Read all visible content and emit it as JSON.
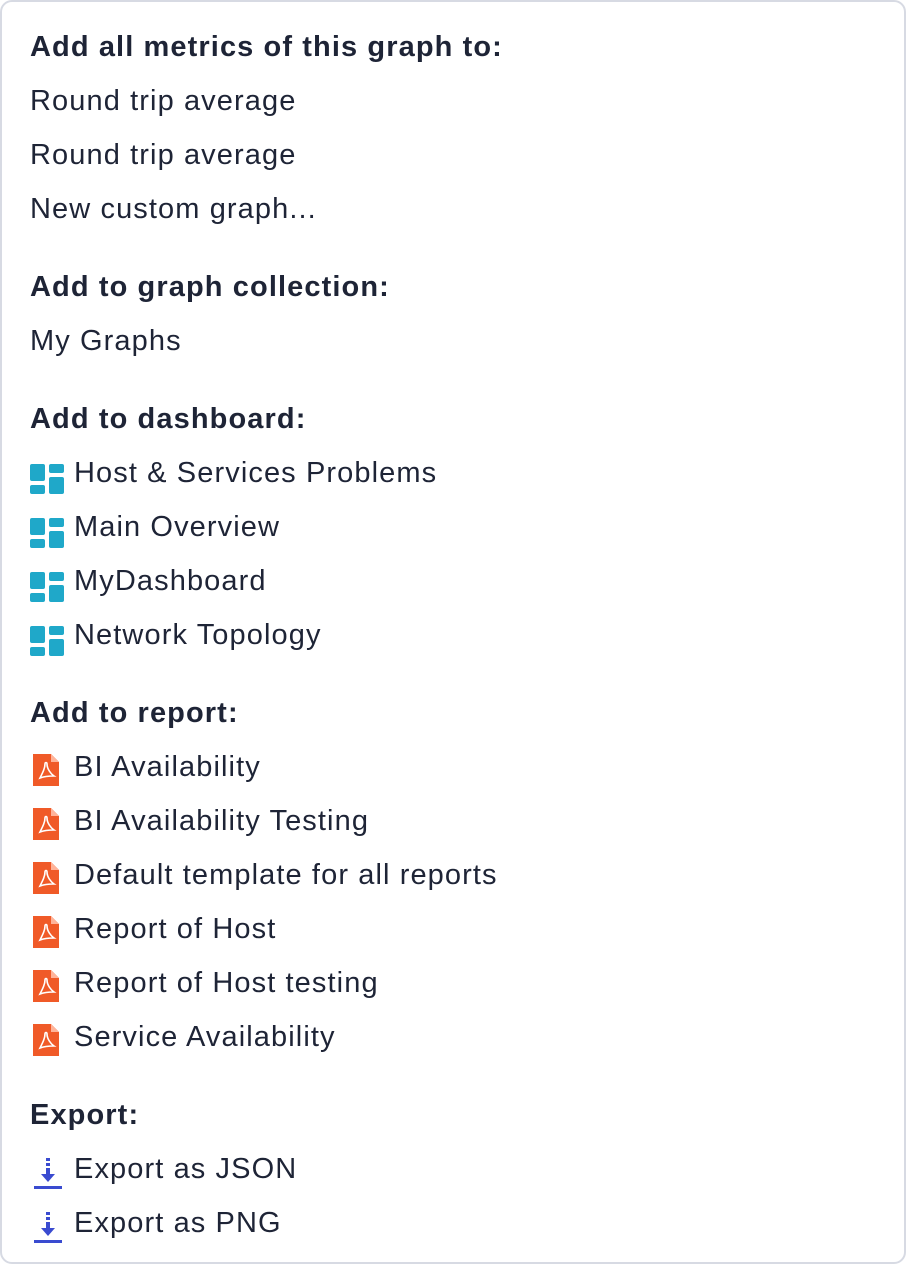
{
  "sections": {
    "metrics": {
      "heading": "Add all metrics of this graph to:",
      "items": [
        "Round trip average",
        "Round trip average",
        "New custom graph..."
      ]
    },
    "collection": {
      "heading": "Add to graph collection:",
      "items": [
        "My Graphs"
      ]
    },
    "dashboard": {
      "heading": "Add to dashboard:",
      "icon": "dashboard-icon",
      "items": [
        "Host & Services Problems",
        "Main Overview",
        "MyDashboard",
        "Network Topology"
      ]
    },
    "report": {
      "heading": "Add to report:",
      "icon": "pdf-icon",
      "items": [
        "BI Availability",
        "BI Availability Testing",
        "Default template for all reports",
        "Report of Host",
        "Report of Host testing",
        "Service Availability"
      ]
    },
    "export": {
      "heading": "Export:",
      "icon": "download-icon",
      "items": [
        "Export as JSON",
        "Export as PNG"
      ]
    }
  },
  "colors": {
    "text": "#1e2436",
    "dashboard_icon": "#1fa8c9",
    "pdf_icon": "#f05a28",
    "download_icon": "#3a4bd0",
    "border": "#d7dae3"
  }
}
